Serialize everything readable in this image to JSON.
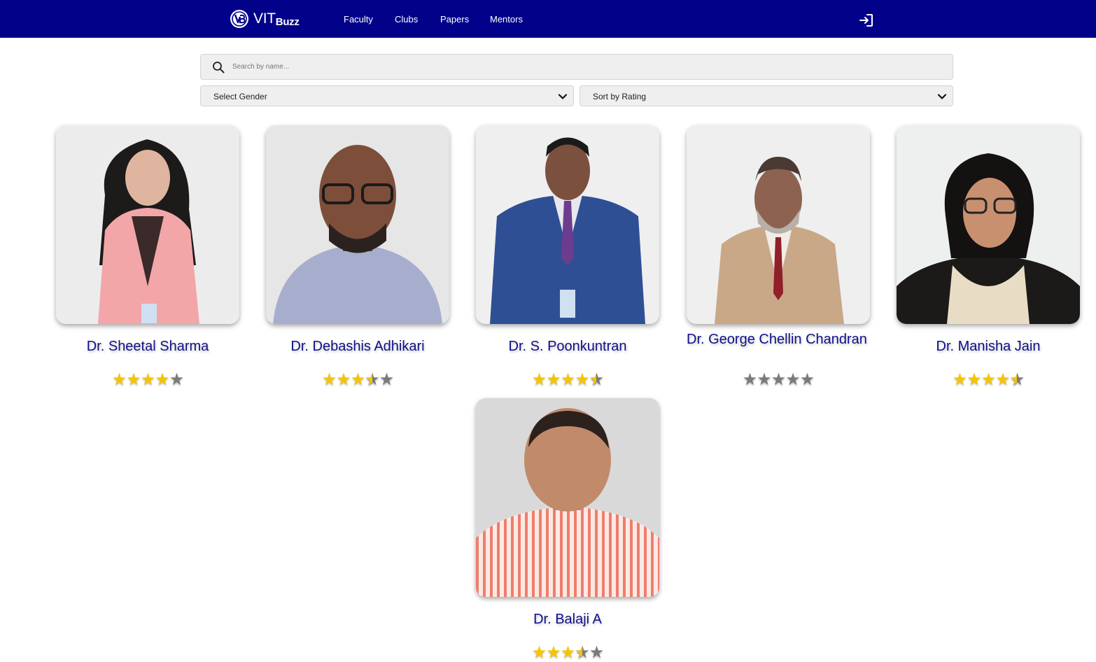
{
  "brand": {
    "name": "VIT",
    "suffix": "Buzz",
    "icon": "vitbuzz-logo-icon"
  },
  "nav": {
    "links": [
      {
        "label": "Faculty"
      },
      {
        "label": "Clubs"
      },
      {
        "label": "Papers"
      },
      {
        "label": "Mentors"
      }
    ],
    "login_icon": "login-icon"
  },
  "search": {
    "placeholder": "Search by name...",
    "value": "",
    "icon": "search-icon"
  },
  "filters": {
    "gender_label": "Select Gender",
    "sort_label": "Sort by Rating"
  },
  "colors": {
    "navbar": "#01018a",
    "name_text": "#10108a",
    "star_filled": "#f5c400",
    "star_empty": "#7a7a7a"
  },
  "faculty": [
    {
      "name": "Dr. Sheetal Sharma",
      "rating": 4
    },
    {
      "name": "Dr. Debashis Adhikari",
      "rating": 3.5
    },
    {
      "name": "Dr. S. Poonkuntran",
      "rating": 4.5
    },
    {
      "name": "Dr. George Chellin Chandran",
      "rating": 0
    },
    {
      "name": "Dr. Manisha Jain",
      "rating": 4.5
    },
    {
      "name": "Dr. Balaji A",
      "rating": 3.5
    }
  ]
}
